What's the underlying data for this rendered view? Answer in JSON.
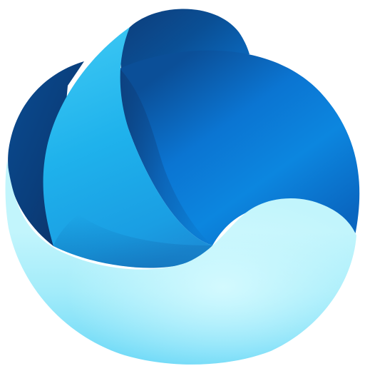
{
  "logo": {
    "icon": "layered-sphere-wave-logo-icon",
    "colors": {
      "background": "#ffffff",
      "deep_navy": "#0b3f7f",
      "mid_blue": "#0a73d1",
      "bright_blue": "#0e8be0",
      "sky_blue": "#35c3f1",
      "cyan": "#6ad8f7",
      "pale_aqua": "#b6f2fb"
    }
  }
}
